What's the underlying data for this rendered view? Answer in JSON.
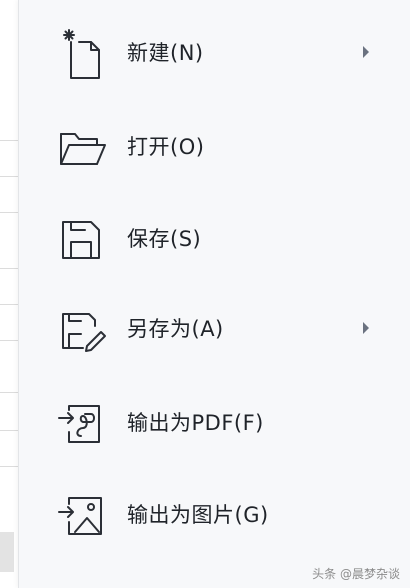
{
  "menu": {
    "items": [
      {
        "label": "新建(N)",
        "icon": "new-file-icon",
        "has_submenu": true
      },
      {
        "label": "打开(O)",
        "icon": "folder-open-icon",
        "has_submenu": false
      },
      {
        "label": "保存(S)",
        "icon": "save-icon",
        "has_submenu": false
      },
      {
        "label": "另存为(A)",
        "icon": "save-as-icon",
        "has_submenu": true
      },
      {
        "label": "输出为PDF(F)",
        "icon": "export-pdf-icon",
        "has_submenu": false
      },
      {
        "label": "输出为图片(G)",
        "icon": "export-image-icon",
        "has_submenu": false
      }
    ]
  },
  "watermark": "头条 @晨梦杂谈",
  "colors": {
    "menu_bg": "#f7f8fa",
    "text": "#1f2329",
    "icon_stroke": "#2b2f36",
    "arrow": "#6b7280"
  }
}
